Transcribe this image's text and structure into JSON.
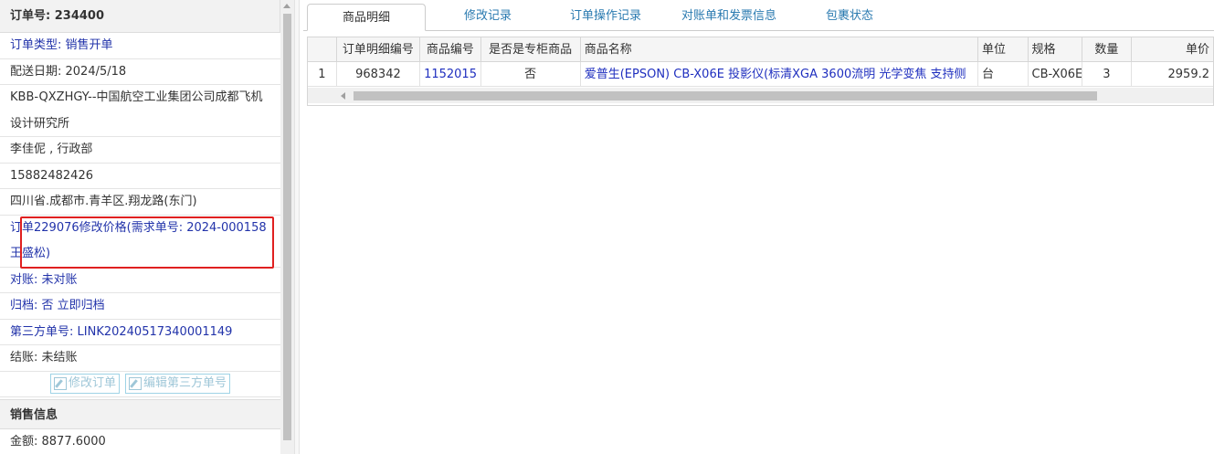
{
  "order": {
    "header_label": "订单号:",
    "header_value": "234400",
    "type": "订单类型: 销售开单",
    "delivery_date": "配送日期: 2024/5/18",
    "company_line1": "KBB-QXZHGY--中国航空工业集团公司成都飞机",
    "company_line2": "设计研究所",
    "contact": "李佳伲 , 行政部",
    "phone": "15882482426",
    "address": "四川省.成都市.青羊区.翔龙路(东门)",
    "note_line1": "订单229076修改价格(需求单号: 2024-000158",
    "note_line2": "王盛松)",
    "reconcile": "对账: 未对账",
    "archive_label": "归档: ",
    "archive_value": "否 立即归档",
    "third_party": "第三方单号: LINK20240517340001149",
    "settle": "结账: 未结账",
    "btn_edit_order": "修改订单",
    "btn_edit_third": "编辑第三方单号",
    "sales_section": "销售信息",
    "amount": "金额: 8877.6000"
  },
  "tabs": [
    {
      "label": "商品明细",
      "active": true
    },
    {
      "label": "修改记录"
    },
    {
      "label": "订单操作记录"
    },
    {
      "label": "对账单和发票信息"
    },
    {
      "label": "包裹状态"
    }
  ],
  "grid": {
    "headers": [
      "订单明细编号",
      "商品编号",
      "是否是专柜商品",
      "商品名称",
      "单位",
      "规格",
      "数量",
      "单价"
    ],
    "rows": [
      {
        "num": "1",
        "detail_id": "968342",
        "product_code": "1152015",
        "is_special": "否",
        "name": "爱普生(EPSON) CB-X06E 投影仪(标清XGA 3600流明 光学变焦 支持侧",
        "unit": "台",
        "spec": "CB-X06E",
        "qty": "3",
        "price": "2959.2"
      }
    ]
  },
  "colors": {
    "link": "#1f2fbf",
    "highlight": "#e02020",
    "tab_text": "#2a7ab0"
  }
}
